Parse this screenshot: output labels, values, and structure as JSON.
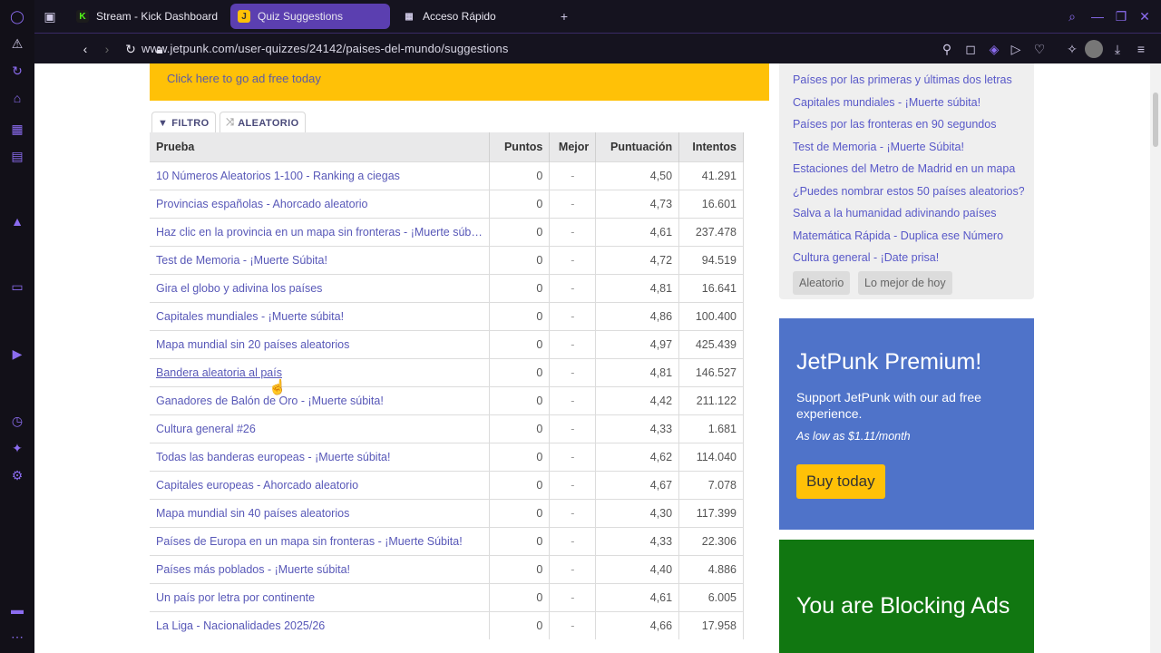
{
  "browser": {
    "tabs": [
      {
        "label": "Stream - Kick Dashboard",
        "icon": "K"
      },
      {
        "label": "Quiz Suggestions",
        "icon": "J"
      },
      {
        "label": "Acceso Rápido",
        "icon": "grid"
      }
    ],
    "url": "www.jetpunk.com/user-quizzes/24142/paises-del-mundo/suggestions"
  },
  "page": {
    "ad_banner": "Click here to go ad free today",
    "filter_tabs": {
      "filtro": "FILTRO",
      "aleatorio": "ALEATORIO"
    },
    "table": {
      "headers": [
        "Prueba",
        "Puntos",
        "Mejor",
        "Puntuación",
        "Intentos"
      ],
      "rows": [
        [
          "10 Números Aleatorios 1-100 - Ranking a ciegas",
          "0",
          "-",
          "4,50",
          "41.291"
        ],
        [
          "Provincias españolas - Ahorcado aleatorio",
          "0",
          "-",
          "4,73",
          "16.601"
        ],
        [
          "Haz clic en la provincia en un mapa sin fronteras - ¡Muerte súbita!",
          "0",
          "-",
          "4,61",
          "237.478"
        ],
        [
          "Test de Memoria - ¡Muerte Súbita!",
          "0",
          "-",
          "4,72",
          "94.519"
        ],
        [
          "Gira el globo y adivina los países",
          "0",
          "-",
          "4,81",
          "16.641"
        ],
        [
          "Capitales mundiales - ¡Muerte súbita!",
          "0",
          "-",
          "4,86",
          "100.400"
        ],
        [
          "Mapa mundial sin 20 países aleatorios",
          "0",
          "-",
          "4,97",
          "425.439"
        ],
        [
          "Bandera aleatoria al país",
          "0",
          "-",
          "4,81",
          "146.527"
        ],
        [
          "Ganadores de Balón de Oro - ¡Muerte súbita!",
          "0",
          "-",
          "4,42",
          "211.122"
        ],
        [
          "Cultura general #26",
          "0",
          "-",
          "4,33",
          "1.681"
        ],
        [
          "Todas las banderas europeas - ¡Muerte súbita!",
          "0",
          "-",
          "4,62",
          "114.040"
        ],
        [
          "Capitales europeas - Ahorcado aleatorio",
          "0",
          "-",
          "4,67",
          "7.078"
        ],
        [
          "Mapa mundial sin 40 países aleatorios",
          "0",
          "-",
          "4,30",
          "117.399"
        ],
        [
          "Países de Europa en un mapa sin fronteras - ¡Muerte Súbita!",
          "0",
          "-",
          "4,33",
          "22.306"
        ],
        [
          "Países más poblados - ¡Muerte súbita!",
          "0",
          "-",
          "4,40",
          "4.886"
        ],
        [
          "Un país por letra por continente",
          "0",
          "-",
          "4,61",
          "6.005"
        ],
        [
          "La Liga - Nacionalidades 2025/26",
          "0",
          "-",
          "4,66",
          "17.958"
        ]
      ]
    },
    "sidebar_links": [
      "Países por las primeras y últimas dos letras",
      "Capitales mundiales - ¡Muerte súbita!",
      "Países por las fronteras en 90 segundos",
      "Test de Memoria - ¡Muerte Súbita!",
      "Estaciones del Metro de Madrid en un mapa",
      "¿Puedes nombrar estos 50 países aleatorios?",
      "Salva a la humanidad adivinando países",
      "Matemática Rápida - Duplica ese Número",
      "Cultura general - ¡Date prisa!"
    ],
    "sidebar_buttons": {
      "aleatorio": "Aleatorio",
      "mejor": "Lo mejor de hoy"
    },
    "premium": {
      "title": "JetPunk Premium!",
      "desc": "Support JetPunk with our ad free experience.",
      "price": "As low as $1.11/month",
      "button": "Buy today"
    },
    "blocking": {
      "title": "You are Blocking Ads"
    }
  }
}
